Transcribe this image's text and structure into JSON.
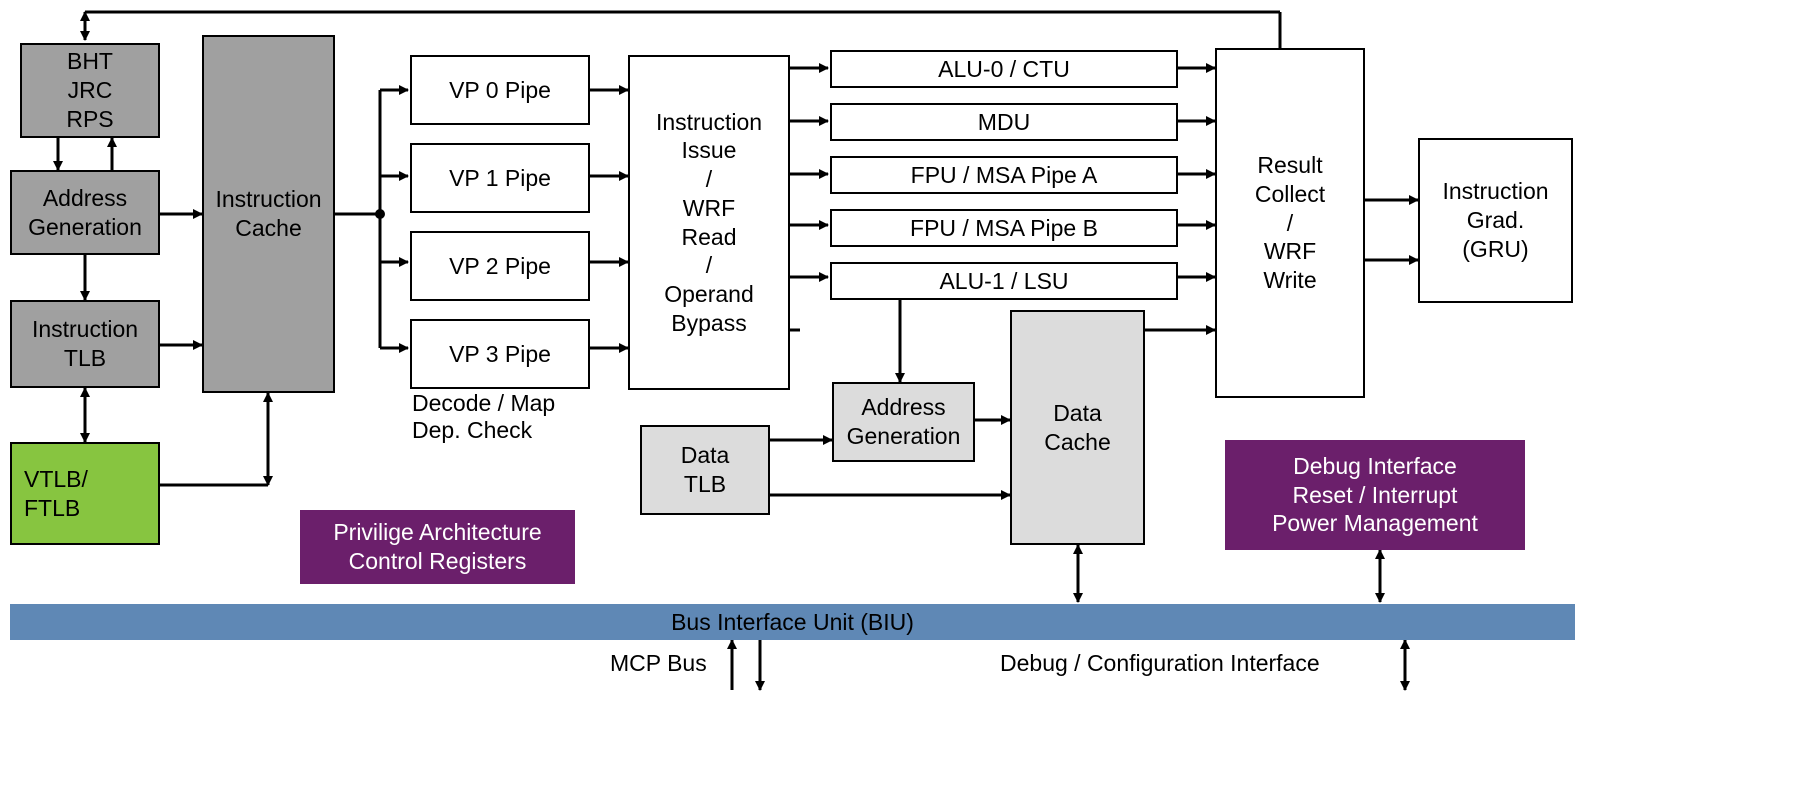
{
  "blocks": {
    "bht": "BHT\nJRC\nRPS",
    "addrgen1": "Address\nGeneration",
    "itlb": "Instruction\nTLB",
    "vtlb": "VTLB/\nFTLB",
    "icache": "Instruction\nCache",
    "vp0": "VP 0 Pipe",
    "vp1": "VP 1 Pipe",
    "vp2": "VP 2 Pipe",
    "vp3": "VP 3 Pipe",
    "decode_label": "Decode / Map\nDep. Check",
    "issue": "Instruction\nIssue\n/\nWRF\nRead\n/\nOperand\nBypass",
    "alu0": "ALU-0 / CTU",
    "mdu": "MDU",
    "fpua": "FPU / MSA Pipe A",
    "fpub": "FPU / MSA Pipe B",
    "alu1": "ALU-1 / LSU",
    "addrgen2": "Address\nGeneration",
    "dtlb": "Data\nTLB",
    "dcache": "Data\nCache",
    "result": "Result\nCollect\n/\nWRF\nWrite",
    "gru": "Instruction\nGrad.\n(GRU)",
    "priv": "Privilige Architecture\nControl Registers",
    "debug": "Debug Interface\nReset / Interrupt\nPower Management",
    "biu": "Bus Interface Unit (BIU)",
    "mcp_label": "MCP Bus",
    "dbgcfg_label": "Debug / Configuration Interface"
  }
}
